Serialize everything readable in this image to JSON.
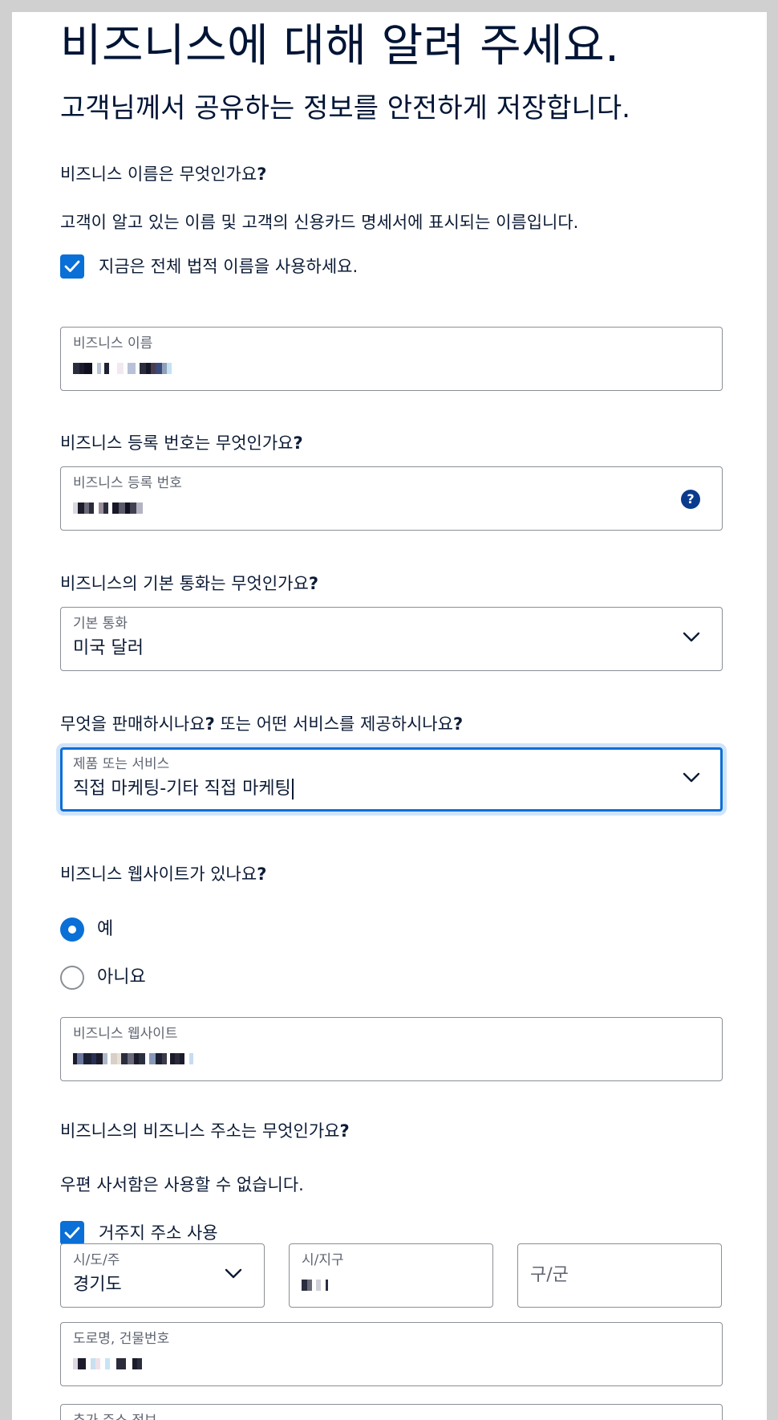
{
  "header": {
    "title": "비즈니스에 대해 알려 주세요.",
    "subtitle": "고객님께서 공유하는 정보를 안전하게 저장합니다."
  },
  "business_name": {
    "question": "비즈니스 이름은 무엇인가요",
    "help_text": "고객이 알고 있는 이름 및 고객의 신용카드 명세서에 표시되는 이름입니다.",
    "checkbox_label": "지금은 전체 법적 이름을 사용하세요.",
    "checkbox_checked": true,
    "field_label": "비즈니스 이름"
  },
  "registration": {
    "question": "비즈니스 등록 번호는 무엇인가요",
    "field_label": "비즈니스 등록 번호",
    "help_icon": "?"
  },
  "currency": {
    "question": "비즈니스의 기본 통화는 무엇인가요",
    "field_label": "기본 통화",
    "value": "미국 달러"
  },
  "product": {
    "question_part1": "무엇을 판매하시나요",
    "question_part2": " 또는 어떤 서비스를 제공하시나요",
    "field_label": "제품 또는 서비스",
    "value": "직접 마케팅-기타 직접 마케팅"
  },
  "website": {
    "question": "비즈니스 웹사이트가 있나요",
    "options": [
      {
        "label": "예",
        "selected": true
      },
      {
        "label": "아니요",
        "selected": false
      }
    ],
    "field_label": "비즈니스 웹사이트"
  },
  "address": {
    "question": "비즈니스의 비즈니스 주소는 무엇인가요",
    "help_text": "우편 사서함은 사용할 수 없습니다.",
    "checkbox_label": "거주지 주소 사용",
    "checkbox_checked": true,
    "province_label": "시/도/주",
    "province_value": "경기도",
    "city_label": "시/지구",
    "district_placeholder": "구/군",
    "street_label": "도로명, 건물번호",
    "extra_label": "추가 주소 정보"
  },
  "punctuation": {
    "qmark": "?"
  },
  "colors": {
    "accent": "#0a6fd6",
    "focus_ring": "#cfe4fb",
    "text": "#0c1b35",
    "label": "#5e6470",
    "border": "#8a8f96",
    "help_icon_bg": "#0b3b8c"
  },
  "icons": {
    "checkmark": "check-icon",
    "dropdown": "chevron-down-icon",
    "help": "question-circle-icon"
  }
}
